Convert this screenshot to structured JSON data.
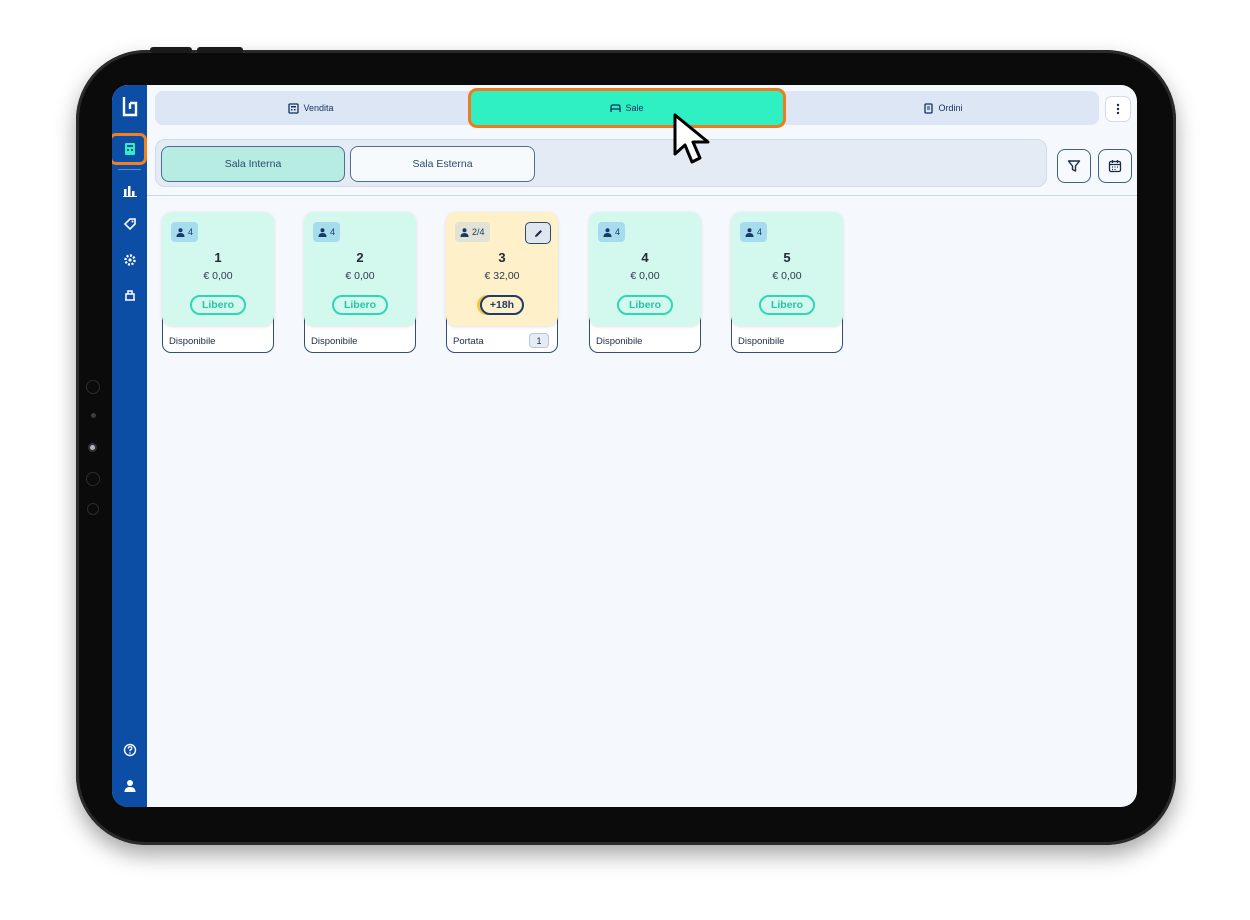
{
  "tabs": [
    {
      "label": "Vendita",
      "icon": "cash-register-icon"
    },
    {
      "label": "Sale",
      "icon": "sofa-icon",
      "active": true
    },
    {
      "label": "Ordini",
      "icon": "receipt-icon"
    }
  ],
  "rooms": [
    {
      "label": "Sala Interna",
      "selected": true
    },
    {
      "label": "Sala Esterna",
      "selected": false
    }
  ],
  "tables": [
    {
      "seats": "4",
      "number": "1",
      "price": "€ 0,00",
      "badge": "Libero",
      "footer": "Disponibile",
      "state": "free"
    },
    {
      "seats": "4",
      "number": "2",
      "price": "€ 0,00",
      "badge": "Libero",
      "footer": "Disponibile",
      "state": "free"
    },
    {
      "seats": "2/4",
      "number": "3",
      "price": "€ 32,00",
      "badge": "+18h",
      "footer": "Portata",
      "footer_count": "1",
      "state": "occupied"
    },
    {
      "seats": "4",
      "number": "4",
      "price": "€ 0,00",
      "badge": "Libero",
      "footer": "Disponibile",
      "state": "free"
    },
    {
      "seats": "4",
      "number": "5",
      "price": "€ 0,00",
      "badge": "Libero",
      "footer": "Disponibile",
      "state": "free"
    }
  ],
  "colors": {
    "sidebar": "#0c4ea6",
    "accent": "#2ff0c2",
    "highlight": "#ef7b1c",
    "free_card": "#d3f8ee",
    "occupied_card": "#fef0c8"
  }
}
